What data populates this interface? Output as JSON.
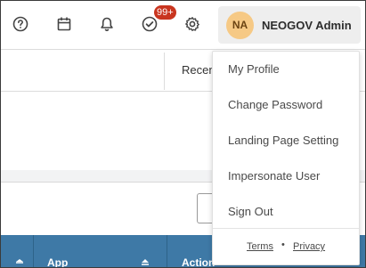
{
  "header": {
    "icons": [
      "help-icon",
      "calendar-icon",
      "bell-icon",
      "tasks-check-icon",
      "gear-icon"
    ],
    "tasks_badge": "99+",
    "user": {
      "initials": "NA",
      "name": "NEOGOV Admin"
    },
    "colors": {
      "badge": "#c9351f",
      "avatar_bg": "#f6c985",
      "profile_bg": "#eeeeee"
    }
  },
  "page": {
    "recent_label": "Recen",
    "table_headers": [
      "App",
      "Action"
    ]
  },
  "dropdown": {
    "items": [
      "My Profile",
      "Change Password",
      "Landing Page Setting",
      "Impersonate User",
      "Sign Out"
    ],
    "footer": {
      "terms": "Terms",
      "separator": "•",
      "privacy": "Privacy"
    }
  },
  "colors": {
    "table_header": "#3e79a6"
  }
}
